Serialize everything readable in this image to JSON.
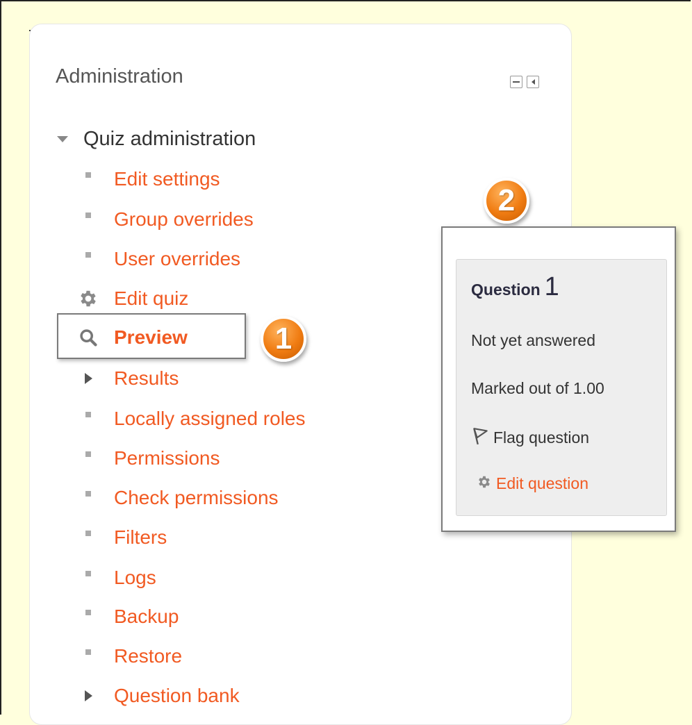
{
  "block": {
    "title": "Administration"
  },
  "tree": {
    "root_label": "Quiz administration",
    "items": [
      {
        "label": "Edit settings",
        "marker": "bullet"
      },
      {
        "label": "Group overrides",
        "marker": "bullet"
      },
      {
        "label": "User overrides",
        "marker": "bullet"
      },
      {
        "label": "Edit quiz",
        "marker": "gear-icon"
      },
      {
        "label": "Preview",
        "marker": "search-icon"
      },
      {
        "label": "Results",
        "marker": "expand-arrow"
      },
      {
        "label": "Locally assigned roles",
        "marker": "bullet"
      },
      {
        "label": "Permissions",
        "marker": "bullet"
      },
      {
        "label": "Check permissions",
        "marker": "bullet"
      },
      {
        "label": "Filters",
        "marker": "bullet"
      },
      {
        "label": "Logs",
        "marker": "bullet"
      },
      {
        "label": "Backup",
        "marker": "bullet"
      },
      {
        "label": "Restore",
        "marker": "bullet"
      },
      {
        "label": "Question bank",
        "marker": "expand-arrow"
      }
    ]
  },
  "callouts": {
    "one": "1",
    "two": "2"
  },
  "question_info": {
    "word": "Question",
    "number": "1",
    "status": "Not yet answered",
    "marks": "Marked out of 1.00",
    "flag_label": "Flag question",
    "edit_label": "Edit question"
  },
  "colors": {
    "link": "#f15a22",
    "badge": "#f07c12",
    "background": "#ffffdd"
  }
}
